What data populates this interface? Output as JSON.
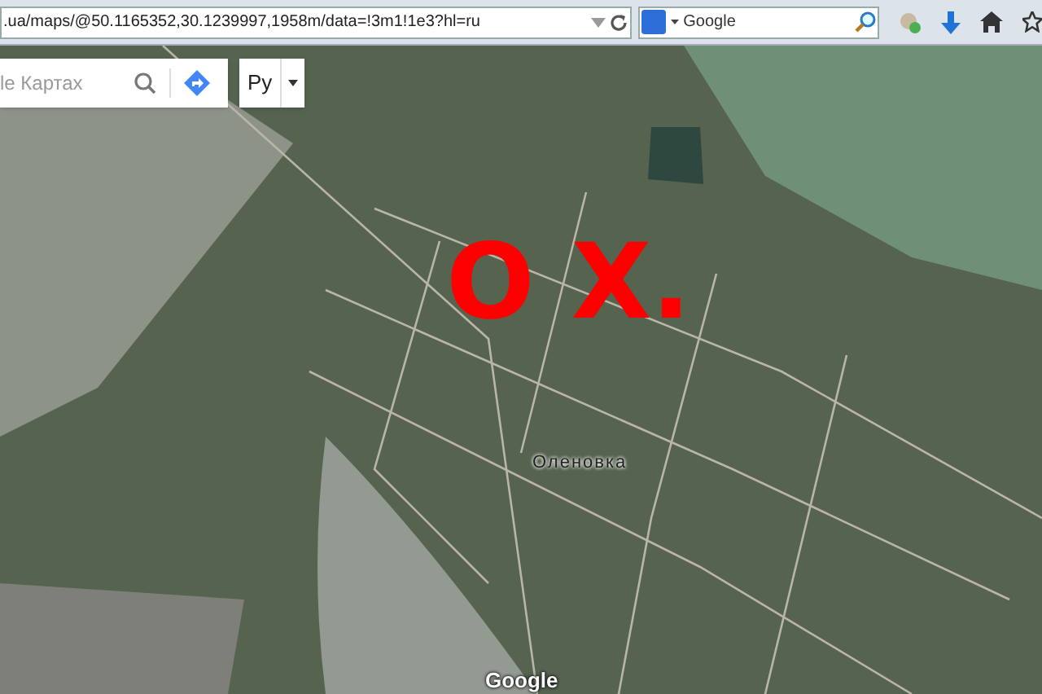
{
  "browser": {
    "address": ".ua/maps/@50.1165352,30.1239997,1958m/data=!3m1!1e3?hl=ru",
    "search_engine": "Google"
  },
  "maps": {
    "search": {
      "placeholder": "le Картах"
    },
    "language": "Ру",
    "place_label": "Оленовка",
    "annotation": "O X.",
    "logo": "Google"
  }
}
